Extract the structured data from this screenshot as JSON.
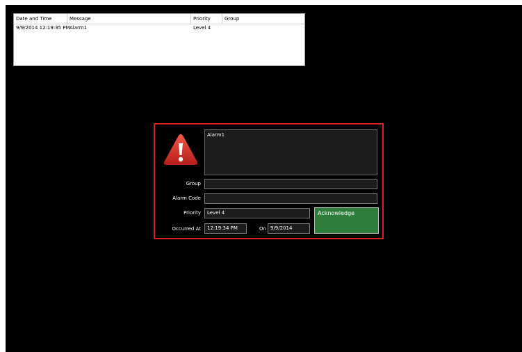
{
  "alarm_list": {
    "columns": [
      "Date and Time",
      "Message",
      "Priority",
      "Group"
    ],
    "rows": [
      [
        "9/9/2014 12:19:35 PM",
        "Alarm1",
        "Level 4",
        ""
      ]
    ]
  },
  "alarm_detail": {
    "message": "Alarm1",
    "group_label": "Group",
    "group_value": "",
    "alarm_code_label": "Alarm Code",
    "alarm_code_value": "",
    "priority_label": "Priority",
    "priority_value": "Level 4",
    "occurred_at_label": "Occurred At",
    "occurred_at_value": "12:19:34 PM",
    "on_label": "On",
    "on_value": "9/9/2014",
    "acknowledge_label": "Acknowledge"
  },
  "colors": {
    "background": "#000000",
    "panel_border": "#d22222",
    "acknowledge": "#2e7d3c",
    "warning_icon": "#d32f2f"
  },
  "icons": {
    "warning": "warning-icon"
  }
}
